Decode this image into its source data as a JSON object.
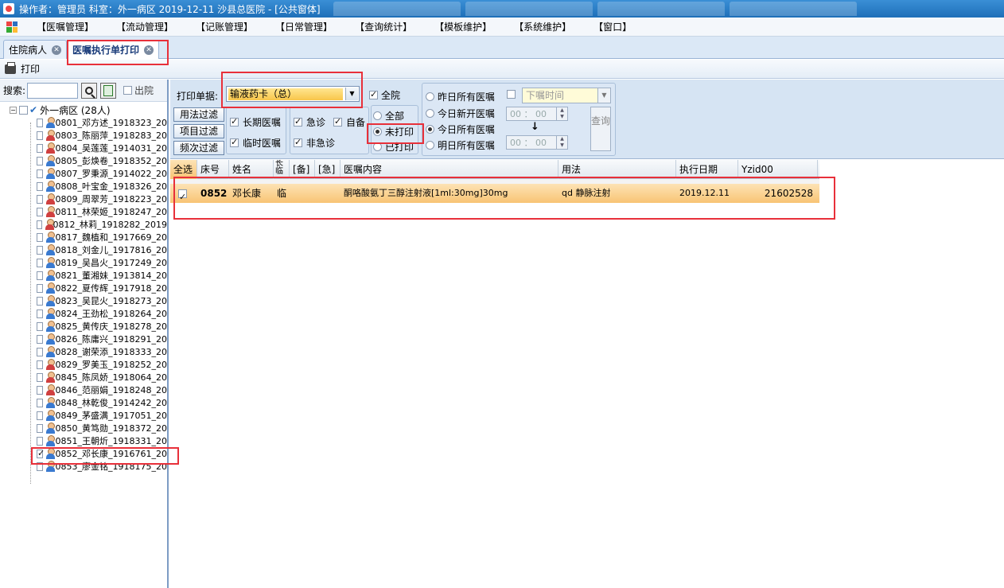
{
  "title_bar": {
    "text": "操作者：管理员  科室：外一病区  2019-12-11  沙县总医院 - [公共窗体]"
  },
  "menu": [
    "【医嘱管理】",
    "【流动管理】",
    "【记账管理】",
    "【日常管理】",
    "【查询统计】",
    "【模板维护】",
    "【系统维护】",
    "【窗口】"
  ],
  "tabs": [
    {
      "label": "住院病人"
    },
    {
      "label": "医嘱执行单打印"
    }
  ],
  "toolbar": {
    "print_label": "打印"
  },
  "search": {
    "label": "搜索:",
    "value": "",
    "discharged_label": "出院"
  },
  "tree": {
    "root_label": "外一病区 (28人)",
    "patients": [
      {
        "text": "0801_邓方述_1918323_20",
        "gender": "m",
        "checked": false
      },
      {
        "text": "0803_陈丽萍_1918283_20",
        "gender": "f",
        "checked": false
      },
      {
        "text": "0804_吴莲莲_1914031_20",
        "gender": "f",
        "checked": false
      },
      {
        "text": "0805_彭焕卷_1918352_20",
        "gender": "m",
        "checked": false
      },
      {
        "text": "0807_罗秉源_1914022_20",
        "gender": "m",
        "checked": false
      },
      {
        "text": "0808_叶宝金_1918326_20",
        "gender": "m",
        "checked": false
      },
      {
        "text": "0809_周翠芳_1918223_20",
        "gender": "f",
        "checked": false
      },
      {
        "text": "0811_林荣姬_1918247_20",
        "gender": "f",
        "checked": false
      },
      {
        "text": "0812_林莉_1918282_2019",
        "gender": "f",
        "checked": false
      },
      {
        "text": "0817_魏植和_1917669_20",
        "gender": "m",
        "checked": false
      },
      {
        "text": "0818_刘金儿_1917816_20",
        "gender": "m",
        "checked": false
      },
      {
        "text": "0819_吴昌火_1917249_20",
        "gender": "m",
        "checked": false
      },
      {
        "text": "0821_董湘妹_1913814_20",
        "gender": "m",
        "checked": false
      },
      {
        "text": "0822_夏传辉_1917918_20",
        "gender": "m",
        "checked": false
      },
      {
        "text": "0823_吴昆火_1918273_20",
        "gender": "m",
        "checked": false
      },
      {
        "text": "0824_王劲松_1918264_20",
        "gender": "m",
        "checked": false
      },
      {
        "text": "0825_黄传庆_1918278_20",
        "gender": "m",
        "checked": false
      },
      {
        "text": "0826_陈庸兴_1918291_20",
        "gender": "m",
        "checked": false
      },
      {
        "text": "0828_谢荣添_1918333_20",
        "gender": "m",
        "checked": false
      },
      {
        "text": "0829_罗美玉_1918252_20",
        "gender": "f",
        "checked": false
      },
      {
        "text": "0845_陈凤娇_1918064_20",
        "gender": "f",
        "checked": false
      },
      {
        "text": "0846_范丽娟_1918248_20",
        "gender": "f",
        "checked": false
      },
      {
        "text": "0848_林乾俊_1914242_20",
        "gender": "m",
        "checked": false
      },
      {
        "text": "0849_茅盛满_1917051_20",
        "gender": "m",
        "checked": false
      },
      {
        "text": "0850_黄笃勋_1918372_20",
        "gender": "m",
        "checked": false
      },
      {
        "text": "0851_王朝炘_1918331_20",
        "gender": "m",
        "checked": false
      },
      {
        "text": "0852_邓长康_1916761_20",
        "gender": "m",
        "checked": true
      },
      {
        "text": "0853_廖金铭_1918175_20",
        "gender": "m",
        "checked": false
      }
    ]
  },
  "filter": {
    "print_basis_label": "打印单据:",
    "print_basis_value": "输液药卡（总）",
    "all_ward_label": "全院",
    "usage_filter": "用法过滤",
    "item_filter": "项目过滤",
    "freq_filter": "频次过滤",
    "long_term": "长期医嘱",
    "temporary": "临时医嘱",
    "urgent": "急诊",
    "self_supply": "自备",
    "non_urgent": "非急诊",
    "radio_all": "全部",
    "radio_unprinted": "未打印",
    "radio_printed": "已打印",
    "yesterday": "昨日所有医嘱",
    "today_new": "今日新开医嘱",
    "today_all": "今日所有医嘱",
    "tomorrow_all": "明日所有医嘱",
    "order_time_placeholder": "下嘱时间",
    "time_from": "00 ： 00",
    "time_to": "00 ： 00",
    "down_arrow": "↓",
    "query": "查询"
  },
  "grid": {
    "headers": [
      "全选",
      "床号",
      "姓名",
      "长临",
      "[备]",
      "[急]",
      "医嘱内容",
      "用法",
      "执行日期",
      "Yzid00"
    ],
    "rows": [
      {
        "checked": true,
        "bed": "0852",
        "name": "邓长康",
        "type": "临",
        "bei": "",
        "ji": "",
        "content": "酮咯酸氨丁三醇注射液[1ml:30mg]30mg",
        "usage": "qd 静脉注射",
        "date": "2019.12.11",
        "id": "21602528"
      }
    ]
  },
  "colors": {
    "highlight": "#e8303a",
    "row_selected": "#f8c474",
    "menu_bg": "#f4f7fb",
    "panel_bg": "#d6e4f3"
  }
}
